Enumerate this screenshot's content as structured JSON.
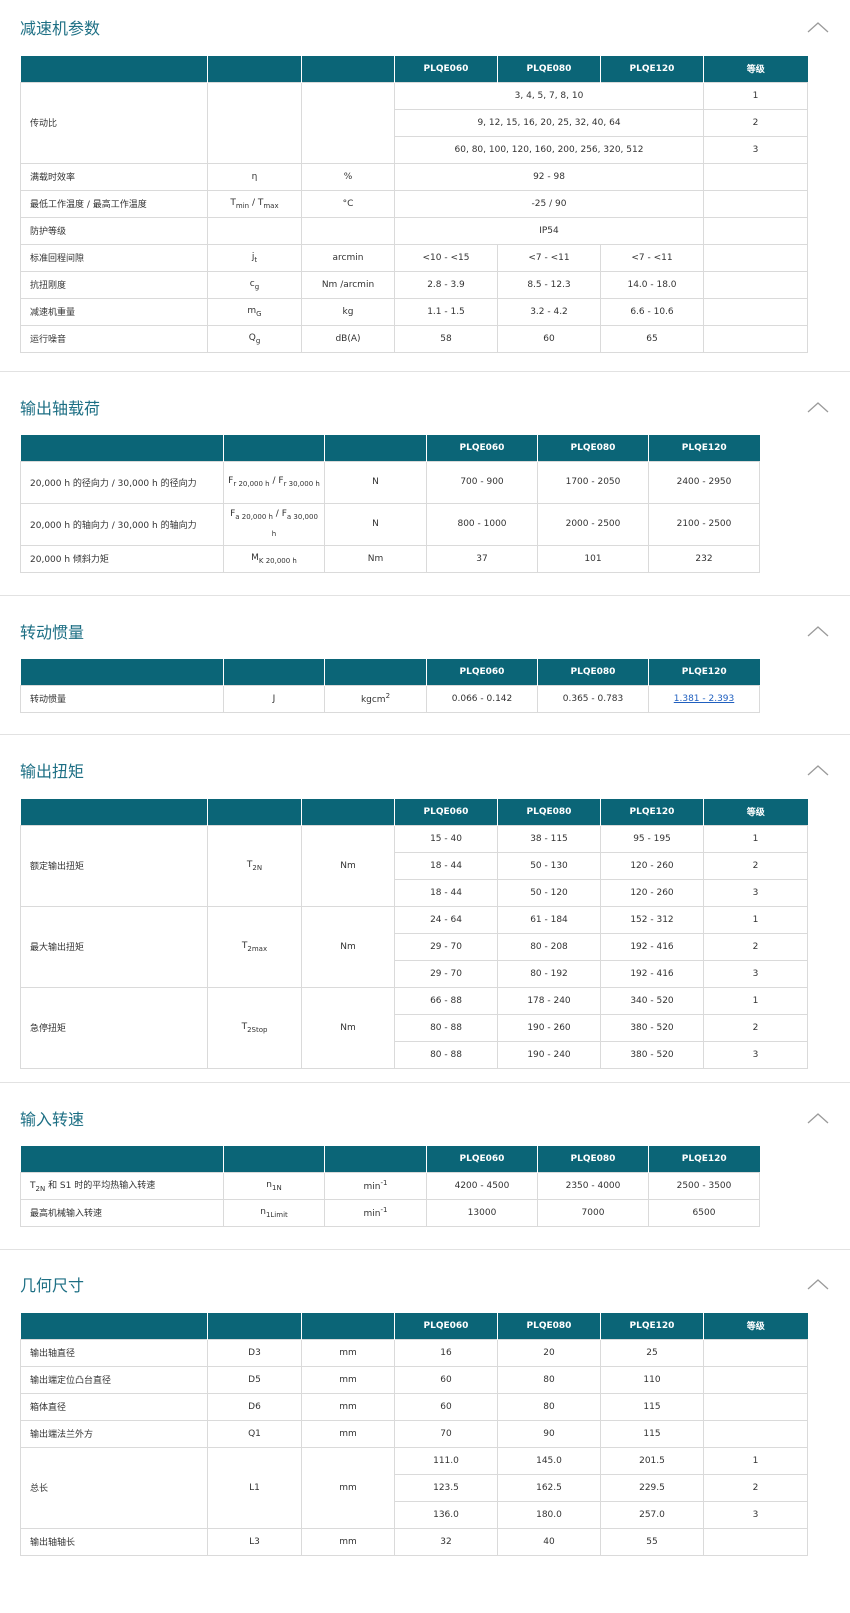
{
  "sections": {
    "params": {
      "title": "减速机参数",
      "headers": [
        "",
        "",
        "",
        "PLQE060",
        "PLQE080",
        "PLQE120",
        "等级"
      ],
      "ratio_label": "传动比",
      "ratio_rows": [
        {
          "value": "3, 4, 5, 7, 8, 10",
          "grade": "1"
        },
        {
          "value": "9, 12, 15, 16, 20, 25, 32, 40, 64",
          "grade": "2"
        },
        {
          "value": "60, 80, 100, 120, 160, 200, 256, 320, 512",
          "grade": "3"
        }
      ],
      "efficiency": {
        "label": "满载时效率",
        "symbol": "η",
        "unit": "%",
        "value": "92 - 98"
      },
      "temperature": {
        "label": "最低工作温度 / 最高工作温度",
        "s1": "T",
        "s1sub": "min",
        "sep": " / ",
        "s2": "T",
        "s2sub": "max",
        "unit": "°C",
        "value": "-25 / 90"
      },
      "protection": {
        "label": "防护等级",
        "value": "IP54"
      },
      "backlash": {
        "label": "标准回程间隙",
        "symbol": "j",
        "sub": "t",
        "unit": "arcmin",
        "v": [
          "<10 - <15",
          "<7 - <11",
          "<7 - <11"
        ]
      },
      "stiffness": {
        "label": "抗扭刚度",
        "symbol": "c",
        "sub": "g",
        "unit": "Nm /arcmin",
        "v": [
          "2.8 - 3.9",
          "8.5 - 12.3",
          "14.0 - 18.0"
        ]
      },
      "weight": {
        "label": "减速机重量",
        "symbol": "m",
        "sub": "G",
        "unit": "kg",
        "v": [
          "1.1 - 1.5",
          "3.2 - 4.2",
          "6.6 - 10.6"
        ]
      },
      "noise": {
        "label": "运行噪音",
        "symbol": "Q",
        "sub": "g",
        "unit": "dB(A)",
        "v": [
          "58",
          "60",
          "65"
        ]
      }
    },
    "load": {
      "title": "输出轴载荷",
      "headers": [
        "",
        "",
        "",
        "PLQE060",
        "PLQE080",
        "PLQE120"
      ],
      "rows": [
        {
          "label": "20,000 h 的径向力 / 30,000 h 的径向力",
          "s1": "F",
          "s1sub": "r 20,000 h",
          "sep": " / ",
          "s2": "F",
          "s2sub": "r 30,000 h",
          "unit": "N",
          "v": [
            "700 - 900",
            "1700 - 2050",
            "2400 - 2950"
          ]
        },
        {
          "label": "20,000 h 的轴向力 / 30,000 h 的轴向力",
          "s1": "F",
          "s1sub": "a 20,000 h",
          "sep": " / ",
          "s2": "F",
          "s2sub": "a 30,000 h",
          "unit": "N",
          "v": [
            "800 - 1000",
            "2000 - 2500",
            "2100 - 2500"
          ]
        },
        {
          "label": "20,000 h 倾斜力矩",
          "s1": "M",
          "s1sub": "K 20,000 h",
          "sep": "",
          "s2": "",
          "s2sub": "",
          "unit": "Nm",
          "v": [
            "37",
            "101",
            "232"
          ]
        }
      ]
    },
    "inertia": {
      "title": "转动惯量",
      "headers": [
        "",
        "",
        "",
        "PLQE060",
        "PLQE080",
        "PLQE120"
      ],
      "row": {
        "label": "转动惯量",
        "symbol": "J",
        "unit": "kgcm",
        "unit_sup": "2",
        "v": [
          "0.066 - 0.142",
          "0.365 - 0.783",
          "1.381 - 2.393"
        ]
      }
    },
    "torque": {
      "title": "输出扭矩",
      "headers": [
        "",
        "",
        "",
        "PLQE060",
        "PLQE080",
        "PLQE120",
        "等级"
      ],
      "groups": [
        {
          "label": "额定输出扭矩",
          "symbol": "T",
          "sub": "2N",
          "unit": "Nm",
          "rows": [
            {
              "v": [
                "15 - 40",
                "38 - 115",
                "95 - 195"
              ],
              "grade": "1"
            },
            {
              "v": [
                "18 - 44",
                "50 - 130",
                "120 - 260"
              ],
              "grade": "2"
            },
            {
              "v": [
                "18 - 44",
                "50 - 120",
                "120 - 260"
              ],
              "grade": "3"
            }
          ]
        },
        {
          "label": "最大输出扭矩",
          "symbol": "T",
          "sub": "2max",
          "unit": "Nm",
          "rows": [
            {
              "v": [
                "24 - 64",
                "61 - 184",
                "152 - 312"
              ],
              "grade": "1"
            },
            {
              "v": [
                "29 - 70",
                "80 - 208",
                "192 - 416"
              ],
              "grade": "2"
            },
            {
              "v": [
                "29 - 70",
                "80 - 192",
                "192 - 416"
              ],
              "grade": "3"
            }
          ]
        },
        {
          "label": "急停扭矩",
          "symbol": "T",
          "sub": "2Stop",
          "unit": "Nm",
          "rows": [
            {
              "v": [
                "66 - 88",
                "178 - 240",
                "340 - 520"
              ],
              "grade": "1"
            },
            {
              "v": [
                "80 - 88",
                "190 - 260",
                "380 - 520"
              ],
              "grade": "2"
            },
            {
              "v": [
                "80 - 88",
                "190 - 240",
                "380 - 520"
              ],
              "grade": "3"
            }
          ]
        }
      ]
    },
    "speed": {
      "title": "输入转速",
      "headers": [
        "",
        "",
        "",
        "PLQE060",
        "PLQE080",
        "PLQE120"
      ],
      "rows": [
        {
          "pre": "T",
          "pre_sub": "2N",
          "label": " 和 S1 时的平均热输入转速",
          "symbol": "n",
          "sub": "1N",
          "unit": "min",
          "unit_sup": "-1",
          "v": [
            "4200 - 4500",
            "2350 - 4000",
            "2500 - 3500"
          ]
        },
        {
          "pre": "",
          "pre_sub": "",
          "label": "最高机械输入转速",
          "symbol": "n",
          "sub": "1Limit",
          "unit": "min",
          "unit_sup": "-1",
          "v": [
            "13000",
            "7000",
            "6500"
          ]
        }
      ]
    },
    "geometry": {
      "title": "几何尺寸",
      "headers": [
        "",
        "",
        "",
        "PLQE060",
        "PLQE080",
        "PLQE120",
        "等级"
      ],
      "rows_before": [
        {
          "label": "输出轴直径",
          "symbol": "D3",
          "unit": "mm",
          "v": [
            "16",
            "20",
            "25"
          ]
        },
        {
          "label": "输出端定位凸台直径",
          "symbol": "D5",
          "unit": "mm",
          "v": [
            "60",
            "80",
            "110"
          ]
        },
        {
          "label": "箱体直径",
          "symbol": "D6",
          "unit": "mm",
          "v": [
            "60",
            "80",
            "115"
          ]
        },
        {
          "label": "输出端法兰外方",
          "symbol": "Q1",
          "unit": "mm",
          "v": [
            "70",
            "90",
            "115"
          ]
        }
      ],
      "length": {
        "label": "总长",
        "symbol": "L1",
        "unit": "mm",
        "rows": [
          {
            "v": [
              "111.0",
              "145.0",
              "201.5"
            ],
            "grade": "1"
          },
          {
            "v": [
              "123.5",
              "162.5",
              "229.5"
            ],
            "grade": "2"
          },
          {
            "v": [
              "136.0",
              "180.0",
              "257.0"
            ],
            "grade": "3"
          }
        ]
      },
      "shaft_len": {
        "label": "输出轴轴长",
        "symbol": "L3",
        "unit": "mm",
        "v": [
          "32",
          "40",
          "55"
        ]
      }
    }
  }
}
